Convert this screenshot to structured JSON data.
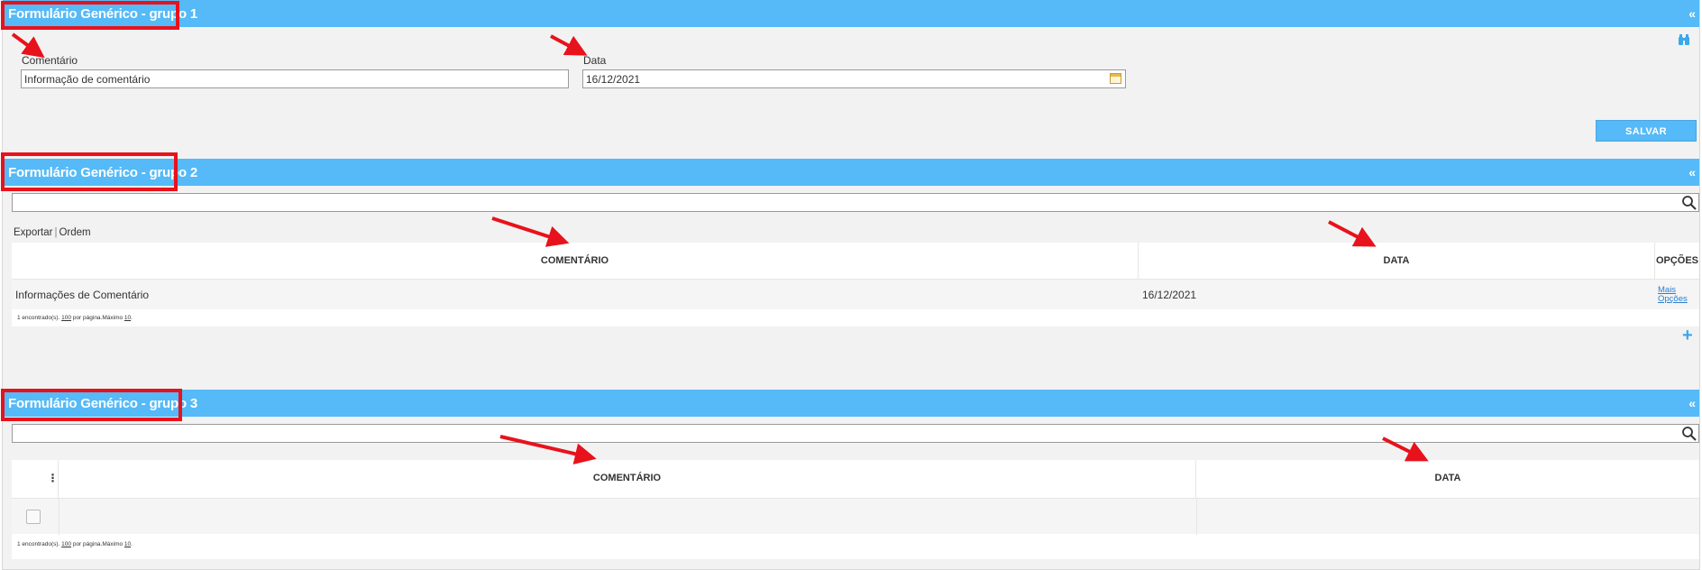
{
  "group1": {
    "title": "Formulário Genérico - grupo 1",
    "collapse_glyph": "«",
    "comentario_label": "Comentário",
    "comentario_value": "Informação de comentário",
    "data_label": "Data",
    "data_value": "16/12/2021",
    "save_label": "SALVAR"
  },
  "group2": {
    "title": "Formulário Genérico - grupo 2",
    "collapse_glyph": "«",
    "search_value": "",
    "toolbar": {
      "exportar": "Exportar",
      "separator": "|",
      "ordem": "Ordem"
    },
    "columns": [
      "COMENTÁRIO",
      "DATA",
      "OPÇÕES"
    ],
    "rows": [
      {
        "comentario": "Informações de Comentário",
        "data": "16/12/2021",
        "opcoes_line1": "Mais",
        "opcoes_line2": "Opções"
      }
    ],
    "footer": {
      "found": "1 encontrado(s).",
      "per_page_value": "100",
      "per_page_text": "por página.Máximo",
      "max_value": "10",
      "end": "."
    },
    "add_glyph": "+"
  },
  "group3": {
    "title": "Formulário Genérico - grupo 3",
    "collapse_glyph": "«",
    "search_value": "",
    "menu_glyph": "⋮",
    "columns": [
      "COMENTÁRIO",
      "DATA"
    ],
    "footer": {
      "found": "1 encontrado(s).",
      "per_page_value": "100",
      "per_page_text": "por página.Máximo",
      "max_value": "10",
      "end": "."
    }
  },
  "colors": {
    "header_blue": "#55baf7",
    "annotation_red": "#e8121c",
    "link_blue": "#2a7fd0"
  },
  "icons": [
    "binoculars-icon",
    "calendar-icon",
    "search-icon",
    "plus-icon",
    "collapse-icon",
    "kebab-menu-icon"
  ]
}
